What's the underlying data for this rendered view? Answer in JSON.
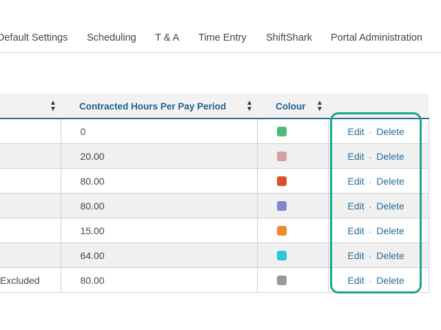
{
  "nav": {
    "items": [
      "Default Settings",
      "Scheduling",
      "T & A",
      "Time Entry",
      "ShiftShark",
      "Portal Administration"
    ]
  },
  "table": {
    "columns": [
      "",
      "Contracted Hours Per Pay Period",
      "Colour",
      ""
    ],
    "sort_icon": "sort-updown-icon",
    "rows": [
      {
        "name": "",
        "hours": "0",
        "colour": "#4cb97a"
      },
      {
        "name": "",
        "hours": "20.00",
        "colour": "#d6a0a0"
      },
      {
        "name": "",
        "hours": "80.00",
        "colour": "#d9512b"
      },
      {
        "name": "",
        "hours": "80.00",
        "colour": "#7f88cc"
      },
      {
        "name": "",
        "hours": "15.00",
        "colour": "#ef8a2a"
      },
      {
        "name": "",
        "hours": "64.00",
        "colour": "#2ec4da"
      },
      {
        "name": "Excluded",
        "hours": "80.00",
        "colour": "#999999"
      }
    ],
    "edit_label": "Edit",
    "separator": "·",
    "delete_label": "Delete"
  },
  "highlight_color": "#1aa58a",
  "link_color": "#2a6c9a"
}
